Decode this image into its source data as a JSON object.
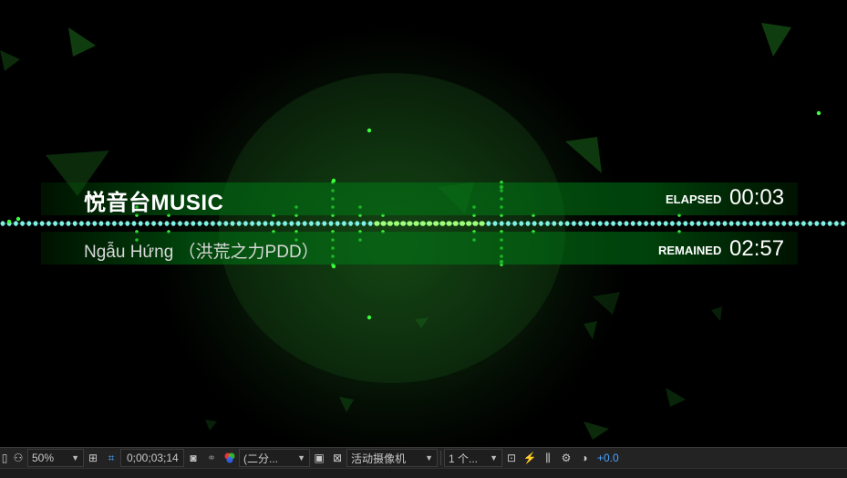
{
  "overlay": {
    "app_title": "悦音台MUSIC",
    "song_title": "Ngẫu Hứng （洪荒之力PDD）",
    "elapsed_label": "ELAPSED",
    "elapsed_value": "00:03",
    "remained_label": "REMAINED",
    "remained_value": "02:57"
  },
  "colors": {
    "dot_cyan": "#7ff2e4",
    "dot_green": "#3cff3c",
    "band_green": "#0a7a14",
    "exposure_blue": "#4aa3ff"
  },
  "toolbar": {
    "magnification": "50%",
    "timecode": "0;00;03;14",
    "resolution": "(二分...",
    "camera": "活动摄像机",
    "views": "1 个...",
    "exposure": "+0.0",
    "icons": [
      "mask-icon",
      "zoom-dropdown",
      "safe-area-icon",
      "transparency-grid-icon",
      "camera-snapshot-icon",
      "show-snapshot-icon",
      "color-channels-icon",
      "region-icon",
      "toggle-transparency-icon",
      "fast-preview-icon",
      "timeline-icon",
      "flowchart-icon",
      "reset-exposure-icon"
    ]
  }
}
